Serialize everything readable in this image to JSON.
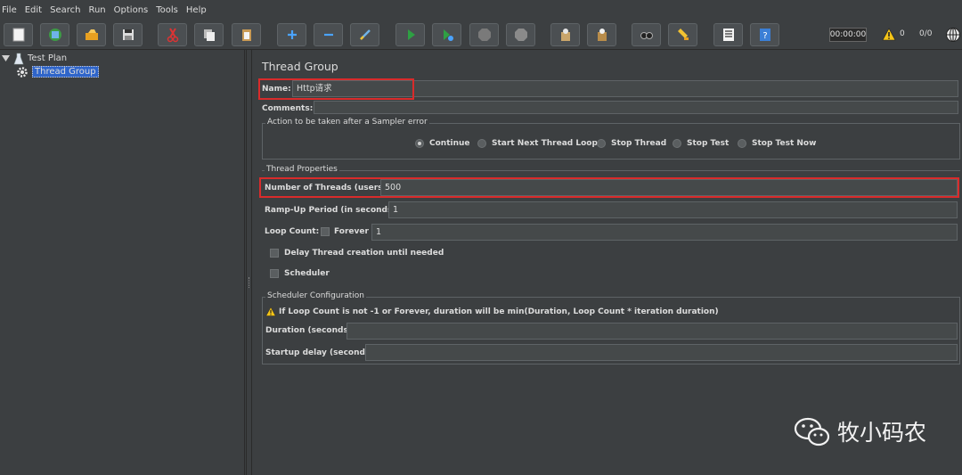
{
  "menu": [
    "File",
    "Edit",
    "Search",
    "Run",
    "Options",
    "Tools",
    "Help"
  ],
  "toolbar": {
    "buttons": [
      "new-icon",
      "templates-icon",
      "open-icon",
      "save-icon",
      "cut-icon",
      "copy-icon",
      "paste-icon",
      "expand-icon",
      "collapse-icon",
      "toggle-icon",
      "start-icon",
      "start-no-pause-icon",
      "stop-icon",
      "shutdown-icon",
      "clear-icon",
      "clear-all-icon",
      "search-icon",
      "reset-search-icon",
      "function-helper-icon",
      "help-icon"
    ],
    "timer": "00:00:00",
    "warning_count": "0",
    "thread_count": "0/0"
  },
  "tree": {
    "items": [
      {
        "label": "Test Plan",
        "icon": "test-plan-icon"
      },
      {
        "label": "Thread Group",
        "icon": "gear-icon"
      }
    ]
  },
  "panel": {
    "title": "Thread Group",
    "name_label": "Name:",
    "name_value": "Http请求",
    "comments_label": "Comments:",
    "sampler_error": {
      "legend": "Action to be taken after a Sampler error",
      "options": [
        "Continue",
        "Start Next Thread Loop",
        "Stop Thread",
        "Stop Test",
        "Stop Test Now"
      ],
      "selected": "Continue"
    },
    "thread_properties": {
      "legend": "Thread Properties",
      "threads_label": "Number of Threads (users):",
      "threads_value": "500",
      "rampup_label": "Ramp-Up Period (in seconds):",
      "rampup_value": "1",
      "loop_label": "Loop Count:",
      "forever_label": "Forever",
      "loop_value": "1",
      "delay_label": "Delay Thread creation until needed",
      "scheduler_label": "Scheduler"
    },
    "scheduler_config": {
      "legend": "Scheduler Configuration",
      "warning": "If Loop Count is not -1 or Forever, duration will be min(Duration, Loop Count * iteration duration)",
      "duration_label": "Duration (seconds)",
      "duration_value": "",
      "startup_label": "Startup delay (seconds)",
      "startup_value": ""
    }
  },
  "watermark": "牧小码农",
  "colors": {
    "accent_selection": "#2f65ca",
    "highlight_box": "#d92b2b"
  }
}
